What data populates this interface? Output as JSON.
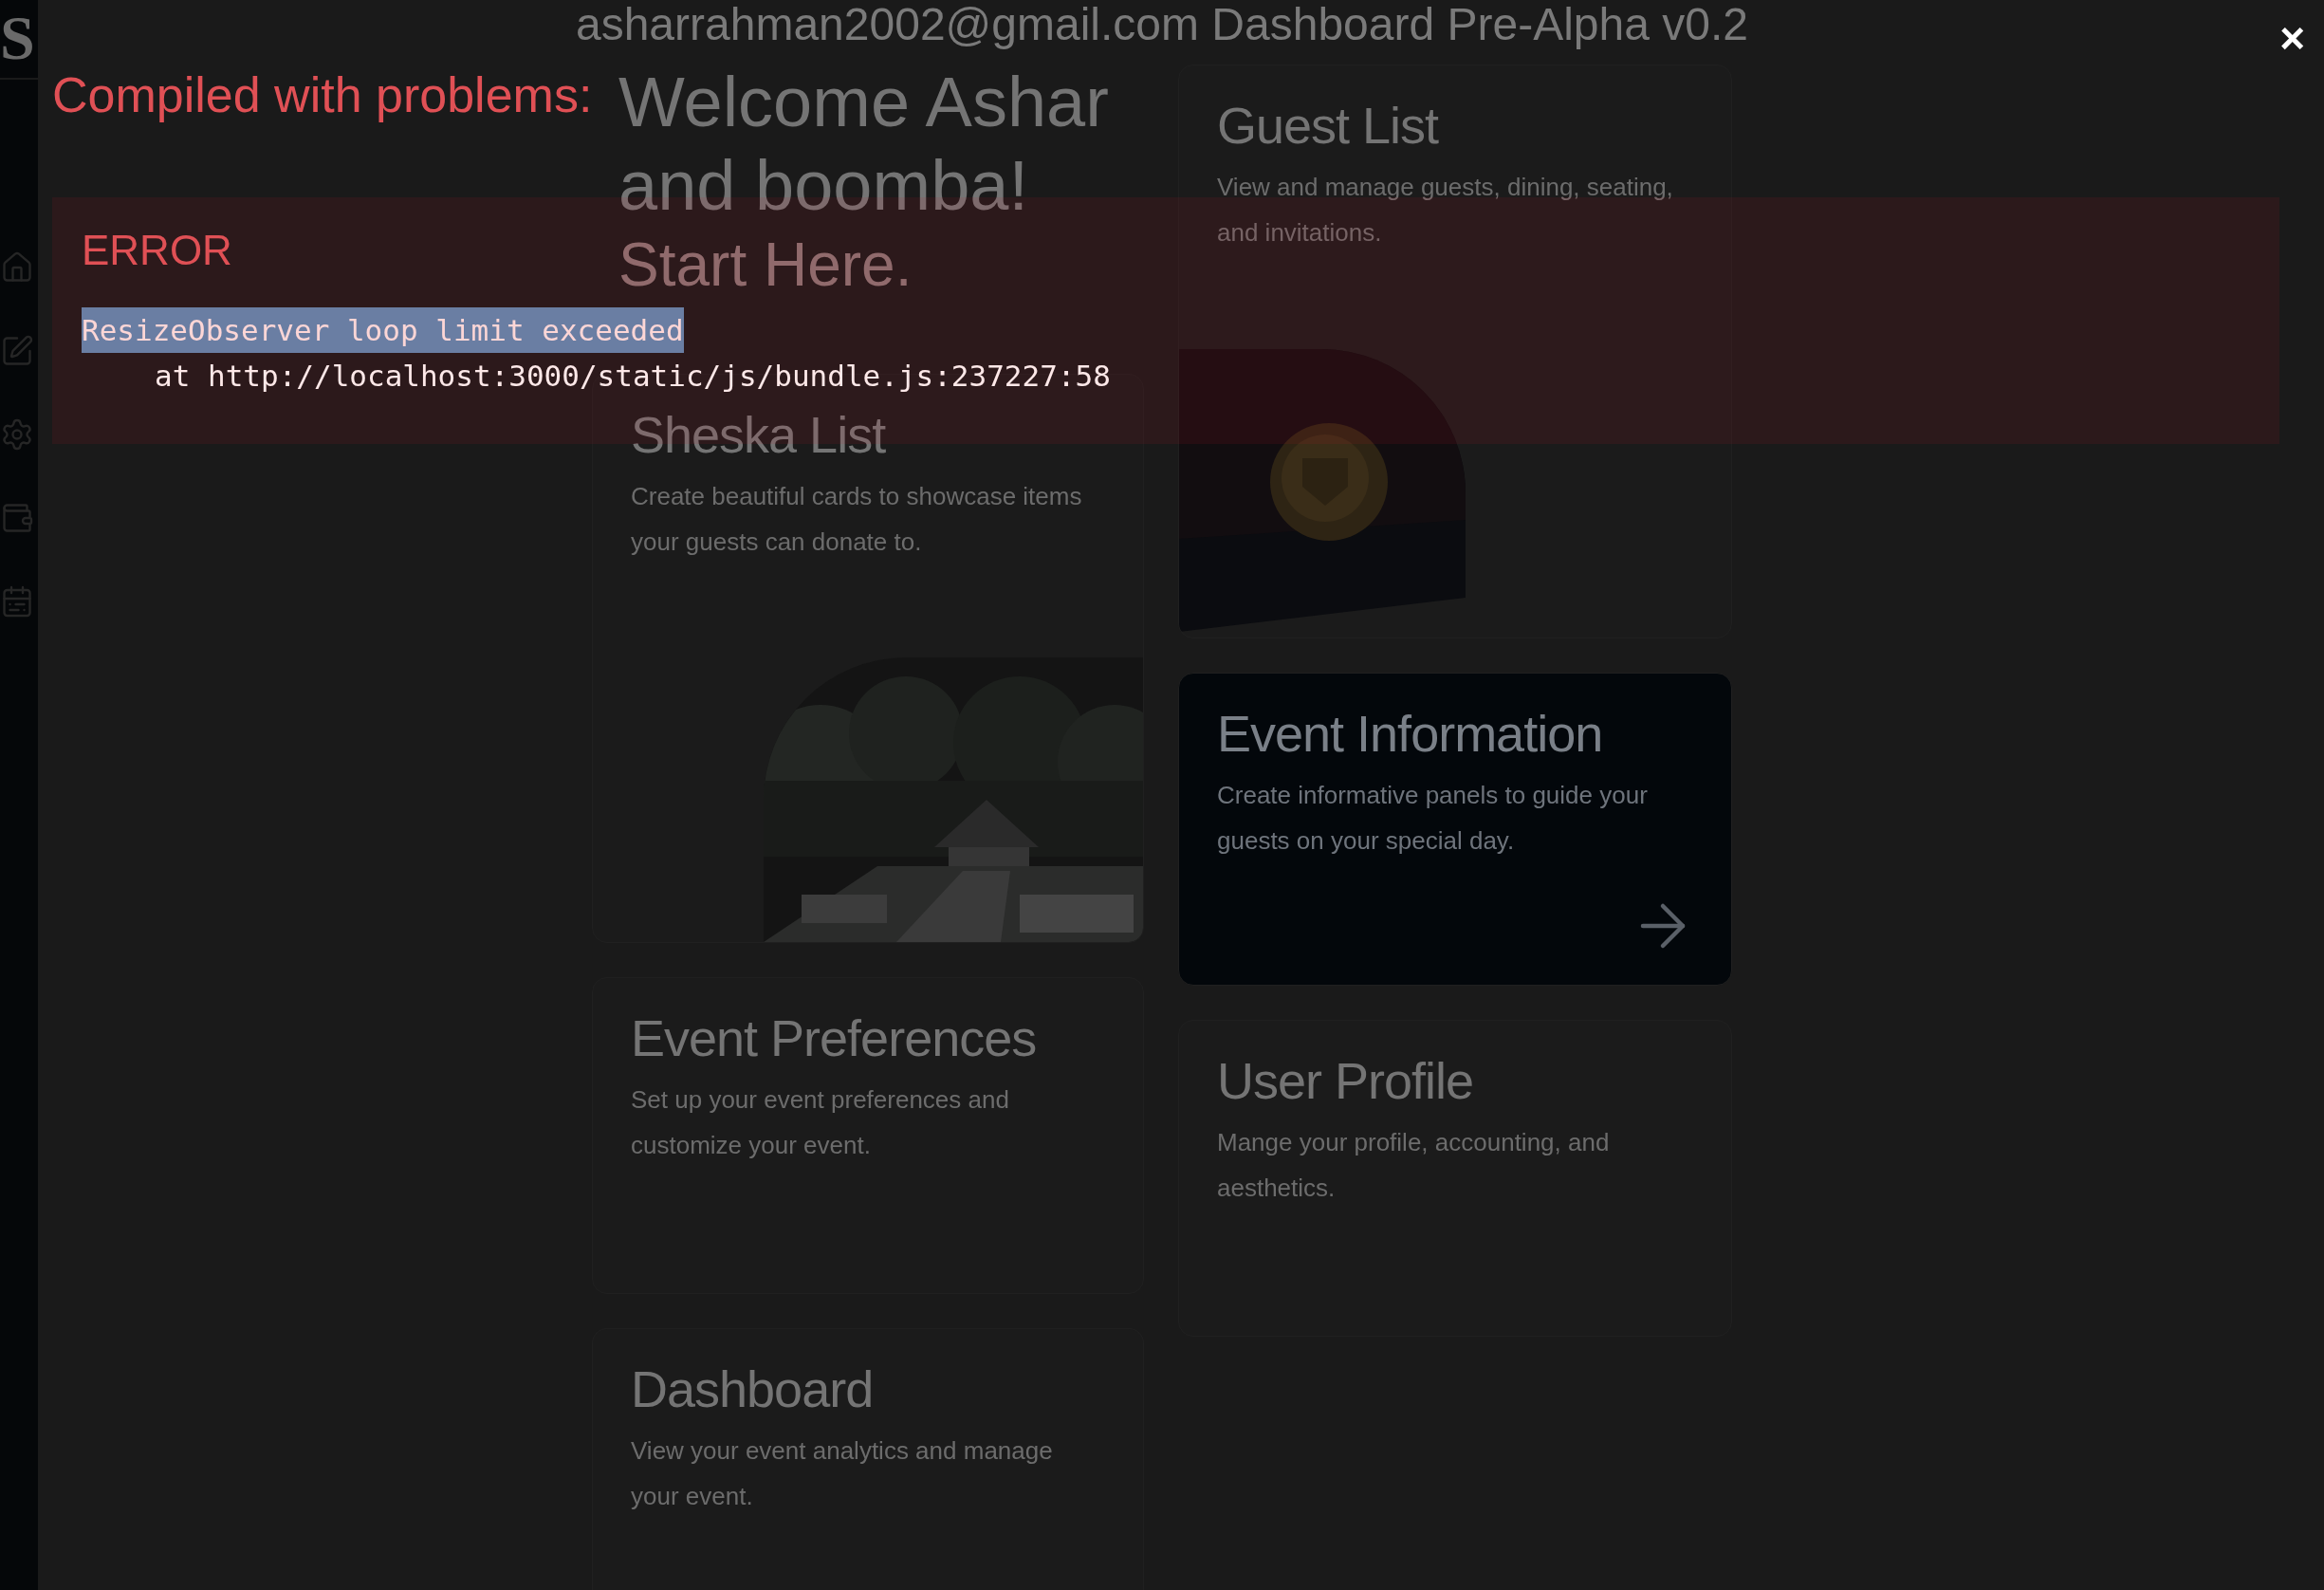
{
  "sidebar": {
    "logo": "S"
  },
  "header": {
    "title": "asharrahman2002@gmail.com Dashboard Pre-Alpha v0.2"
  },
  "welcome": {
    "heading": "Welcome Ashar and boomba!",
    "subheading": "Start Here."
  },
  "left_cards": [
    {
      "title": "Sheska List",
      "description": "Create beautiful cards to showcase items your guests can donate to."
    },
    {
      "kind": "plain",
      "title": "Event Preferences",
      "description": "Set up your event preferences and customize your event."
    },
    {
      "kind": "plain",
      "title": "Dashboard",
      "description": "View your event analytics and manage your event."
    }
  ],
  "right_cards": [
    {
      "kind": "envelope",
      "title": "Guest List",
      "description": "View and manage guests, dining, seating, and invitations."
    },
    {
      "kind": "link",
      "title": "Event Information",
      "description": "Create informative panels to guide your guests on your special day."
    },
    {
      "kind": "plain",
      "title": "User Profile",
      "description": "Mange your profile, accounting, and aesthetics."
    }
  ],
  "error_overlay": {
    "title": "Compiled with problems:",
    "close": "×",
    "errors": [
      {
        "label": "ERROR",
        "message": "ResizeObserver loop limit exceeded",
        "highlighted": true,
        "trace": "at http://localhost:3000/static/js/bundle.js:237227:58"
      }
    ]
  }
}
